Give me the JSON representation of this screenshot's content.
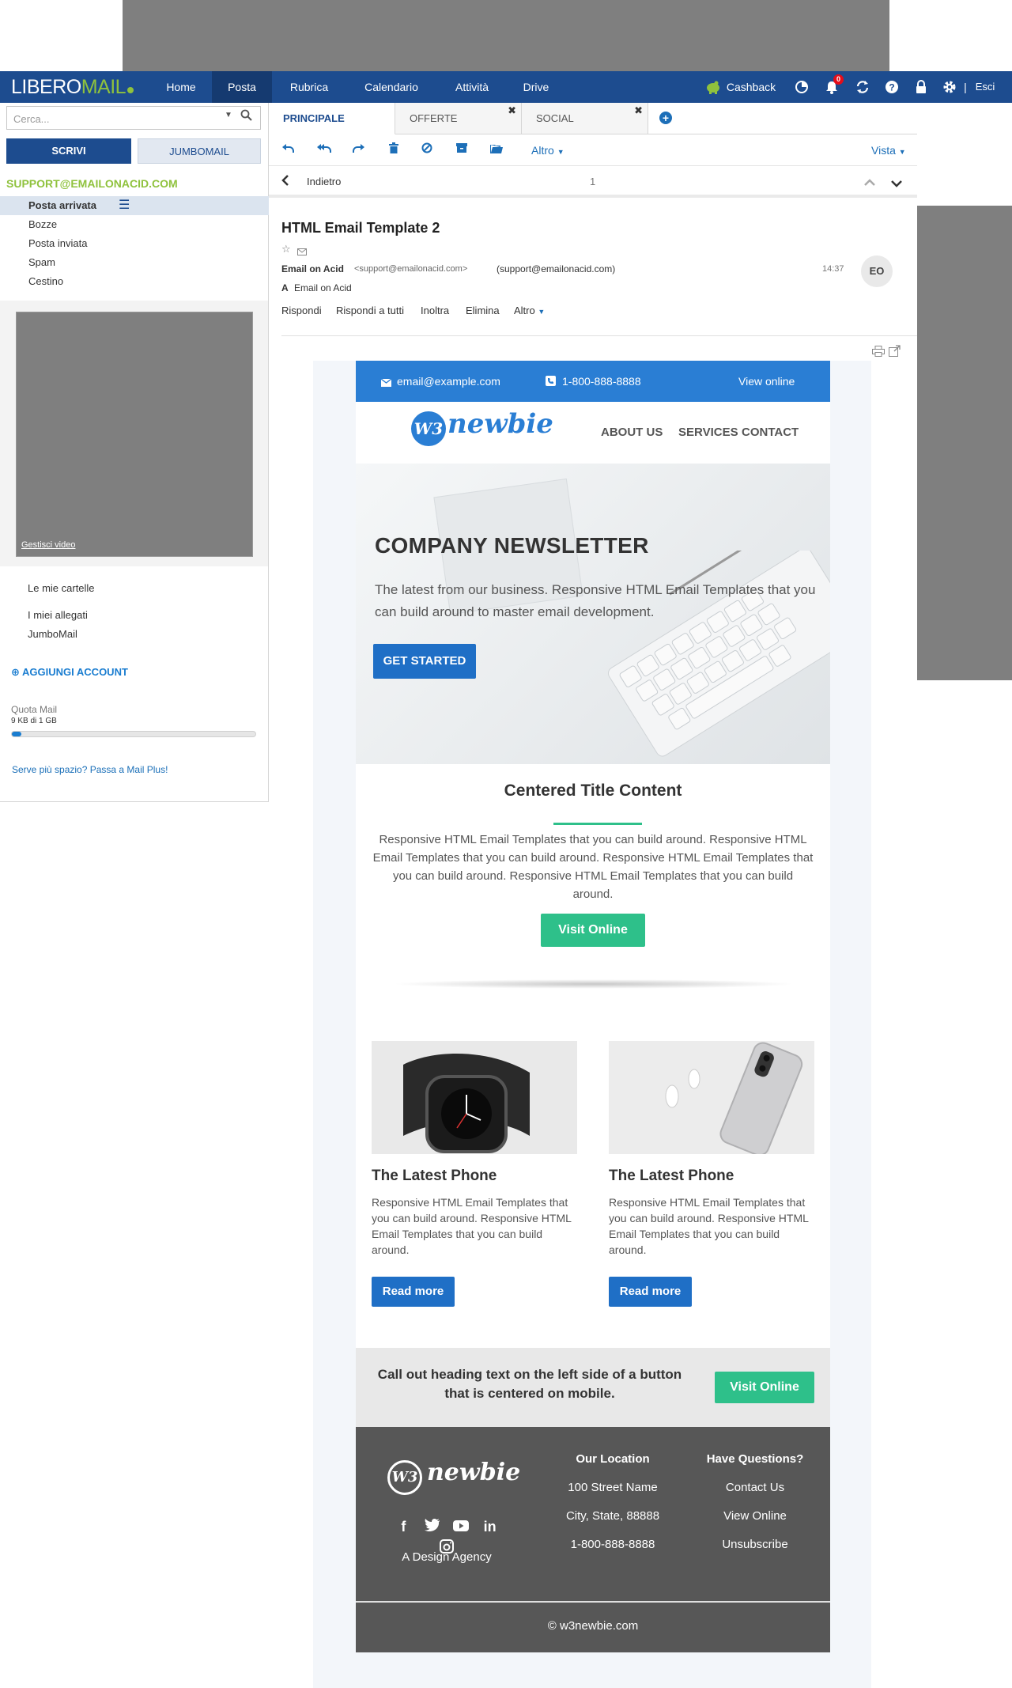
{
  "app": {
    "logo_main": "LIBERO",
    "logo_accent": "MAIL",
    "nav": [
      "Home",
      "Posta",
      "Rubrica",
      "Calendario",
      "Attività",
      "Drive"
    ],
    "cashback": "Cashback",
    "notif_count": "0",
    "logout": "Esci",
    "sep": "|"
  },
  "sidebar": {
    "search_placeholder": "Cerca...",
    "compose": "SCRIVI",
    "jumbomail": "JUMBOMAIL",
    "account": "SUPPORT@EMAILONACID.COM",
    "folders": [
      "Posta arrivata",
      "Bozze",
      "Posta inviata",
      "Spam",
      "Cestino"
    ],
    "video_link": "Gestisci video",
    "my_folders": "Le mie cartelle",
    "attachments": "I miei allegati",
    "jumbo_link": "JumboMail",
    "add_account": "AGGIUNGI ACCOUNT",
    "quota_label": "Quota Mail",
    "quota_value": "9 KB di 1 GB",
    "quota_fraction": 0.04,
    "upsell": "Serve più spazio? Passa a Mail Plus!"
  },
  "tabs": [
    "PRINCIPALE",
    "OFFERTE",
    "SOCIAL"
  ],
  "toolbar": {
    "more": "Altro",
    "view": "Vista"
  },
  "navrow": {
    "back": "Indietro",
    "page": "1"
  },
  "message": {
    "subject": "HTML Email Template 2",
    "from_name": "Email on Acid",
    "from_email": "<support@emailonacid.com>",
    "from_alias": "(support@emailonacid.com)",
    "time": "14:37",
    "avatar": "EO",
    "to_label": "A",
    "to": "Email on Acid",
    "actions": [
      "Rispondi",
      "Rispondi a tutti",
      "Inoltra",
      "Elimina",
      "Altro"
    ]
  },
  "email": {
    "topbar_email": "email@example.com",
    "topbar_phone": "1-800-888-8888",
    "topbar_view": "View online",
    "brand": "newbie",
    "brand_mark": "W3",
    "nav": [
      "ABOUT US",
      "SERVICES",
      "CONTACT"
    ],
    "hero_title": "COMPANY NEWSLETTER",
    "hero_text": "The latest from our business. Responsive HTML Email Templates that you can build around to master email development.",
    "hero_button": "GET STARTED",
    "center_title": "Centered Title Content",
    "center_text": "Responsive HTML Email Templates that you can build around. Responsive HTML Email Templates that you can build around. Responsive HTML Email Templates that you can build around. Responsive HTML Email Templates that you can build around.",
    "center_button": "Visit Online",
    "cards": [
      {
        "title": "The Latest Phone",
        "text": "Responsive HTML Email Templates that you can build around. Responsive HTML Email Templates that you can build around.",
        "button": "Read more"
      },
      {
        "title": "The Latest Phone",
        "text": "Responsive HTML Email Templates that you can build around. Responsive HTML Email Templates that you can build around.",
        "button": "Read more"
      }
    ],
    "callout_text": "Call out heading text on the left side of a button that is centered on mobile.",
    "callout_button": "Visit Online",
    "footer": {
      "tagline": "A Design Agency",
      "location_title": "Our Location",
      "location": [
        "100 Street Name",
        "City, State, 88888",
        "1-800-888-8888"
      ],
      "questions_title": "Have Questions?",
      "questions": [
        "Contact Us",
        "View Online",
        "Unsubscribe"
      ],
      "copyright": "© w3newbie.com"
    }
  },
  "colors": {
    "nav_blue": "#1d4c8f",
    "accent_green": "#8fc23d",
    "email_blue": "#2a7ed4",
    "email_green": "#2ec08a",
    "footer_grey": "#575757"
  }
}
